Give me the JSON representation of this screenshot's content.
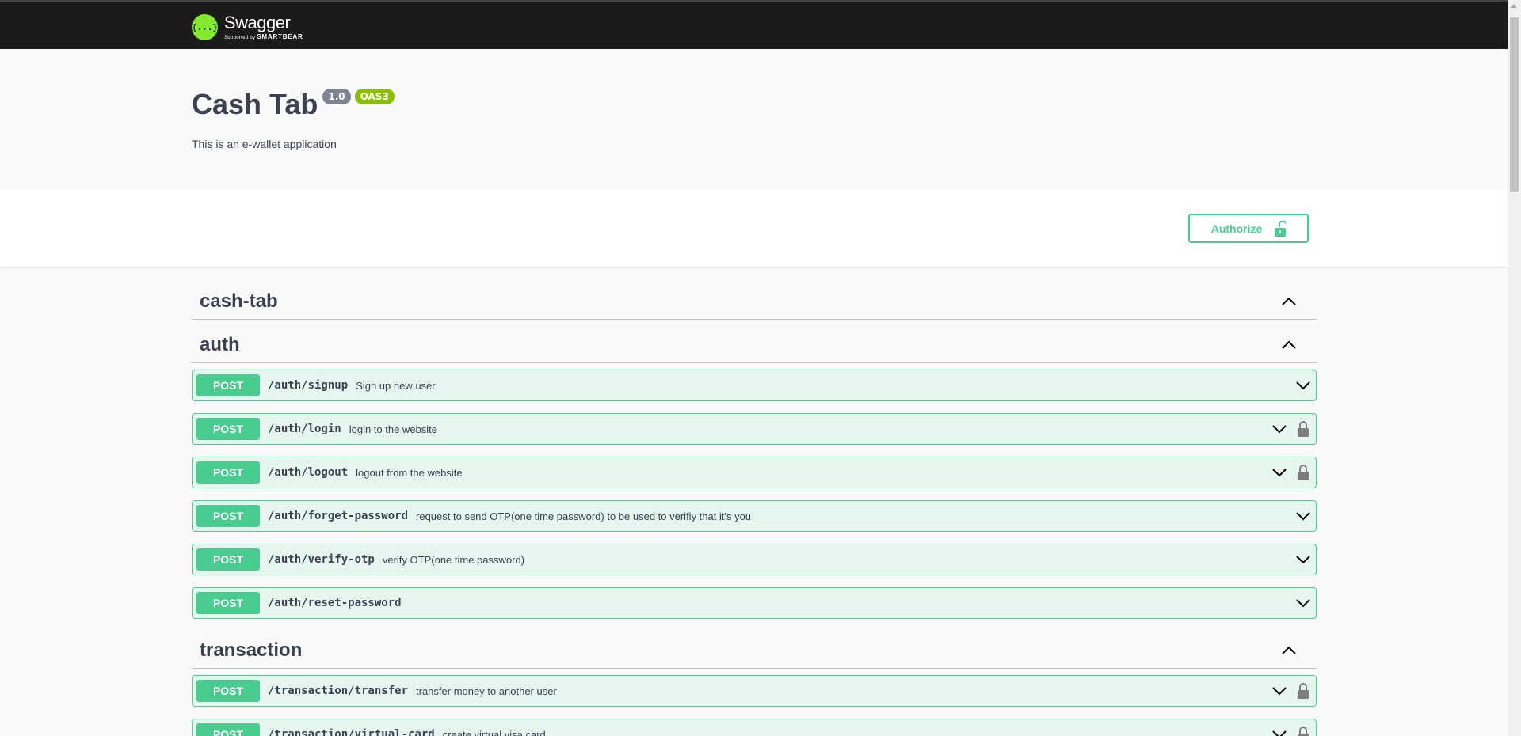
{
  "topbar": {
    "logo_glyph": "{...}",
    "logo_name": "Swagger",
    "logo_supported": "Supported by",
    "logo_brand": "SMARTBEAR"
  },
  "info": {
    "title": "Cash Tab",
    "version": "1.0",
    "oas": "OAS3",
    "description": "This is an e-wallet application"
  },
  "scheme": {
    "authorize_label": "Authorize"
  },
  "tags": [
    {
      "name": "cash-tab"
    },
    {
      "name": "auth"
    },
    {
      "name": "transaction"
    }
  ],
  "operations": [
    {
      "method": "POST",
      "path": "/auth/signup",
      "summary": "Sign up new user",
      "locked": false
    },
    {
      "method": "POST",
      "path": "/auth/login",
      "summary": "login to the website",
      "locked": true
    },
    {
      "method": "POST",
      "path": "/auth/logout",
      "summary": "logout from the website",
      "locked": true
    },
    {
      "method": "POST",
      "path": "/auth/forget-password",
      "summary": "request to send OTP(one time password) to be used to verifiy that it's you",
      "locked": false
    },
    {
      "method": "POST",
      "path": "/auth/verify-otp",
      "summary": "verify OTP(one time password)",
      "locked": false
    },
    {
      "method": "POST",
      "path": "/auth/reset-password",
      "summary": "",
      "locked": false
    },
    {
      "method": "POST",
      "path": "/transaction/transfer",
      "summary": "transfer money to another user",
      "locked": true
    },
    {
      "method": "POST",
      "path": "/transaction/virtual-card",
      "summary": "create virtual visa card",
      "locked": true
    }
  ],
  "colors": {
    "post": "#49cc90",
    "topbar": "#1b1b1b",
    "logo": "#85ea2d",
    "version_badge": "#7d8492",
    "oas_badge": "#89bf04"
  },
  "icons": {
    "tag_toggle": "chevron-up-icon",
    "op_toggle": "chevron-down-icon",
    "op_lock": "lock-icon",
    "authorize_lock": "unlock-icon"
  }
}
